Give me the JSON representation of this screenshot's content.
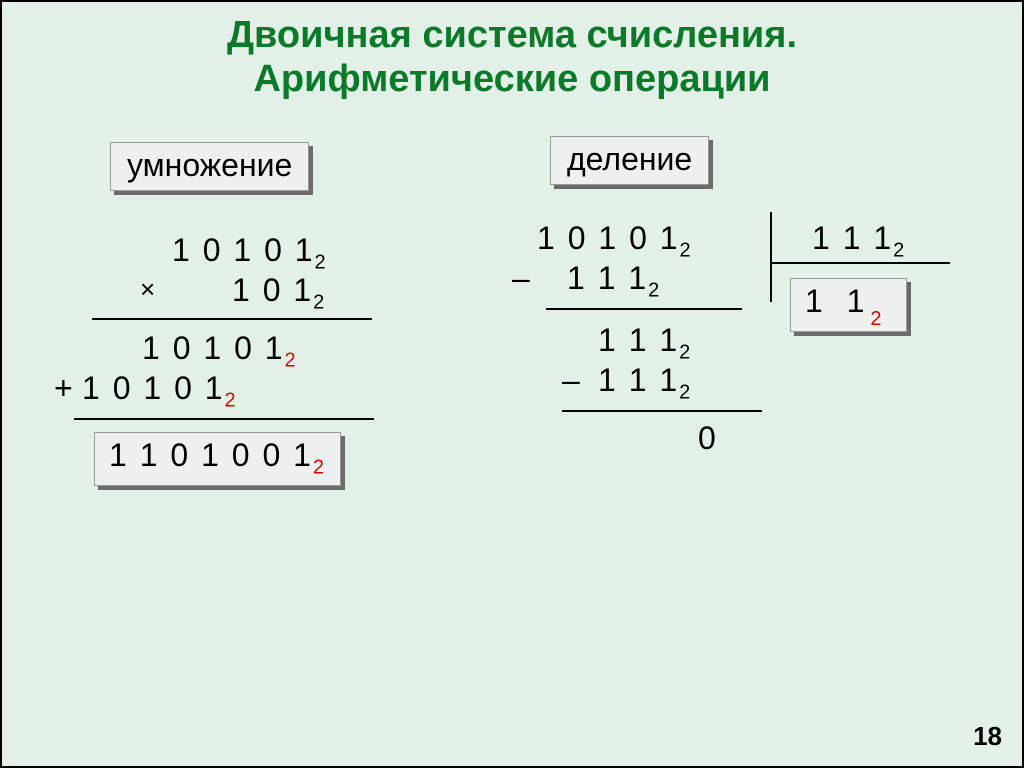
{
  "title_line1": "Двоичная система счисления.",
  "title_line2": "Арифметические операции",
  "labels": {
    "multiplication": "умножение",
    "division": "деление"
  },
  "mult": {
    "operand1": "1 0 1 0 1",
    "operand2": "1 0 1",
    "partial1": "1 0 1 0 1",
    "partial2": "1 0 1 0 1",
    "plus": "+",
    "times": "×",
    "result": "1 1 0 1 0 0 1"
  },
  "div": {
    "dividend": "1 0 1 0 1",
    "divisor": "1 1 1",
    "quotient": "1  1",
    "minus": "–",
    "sub1": "1 1 1",
    "rem1": "1 1 1",
    "sub2": "1 1 1",
    "rem2": "0"
  },
  "subscript": "2",
  "page_number": "18"
}
